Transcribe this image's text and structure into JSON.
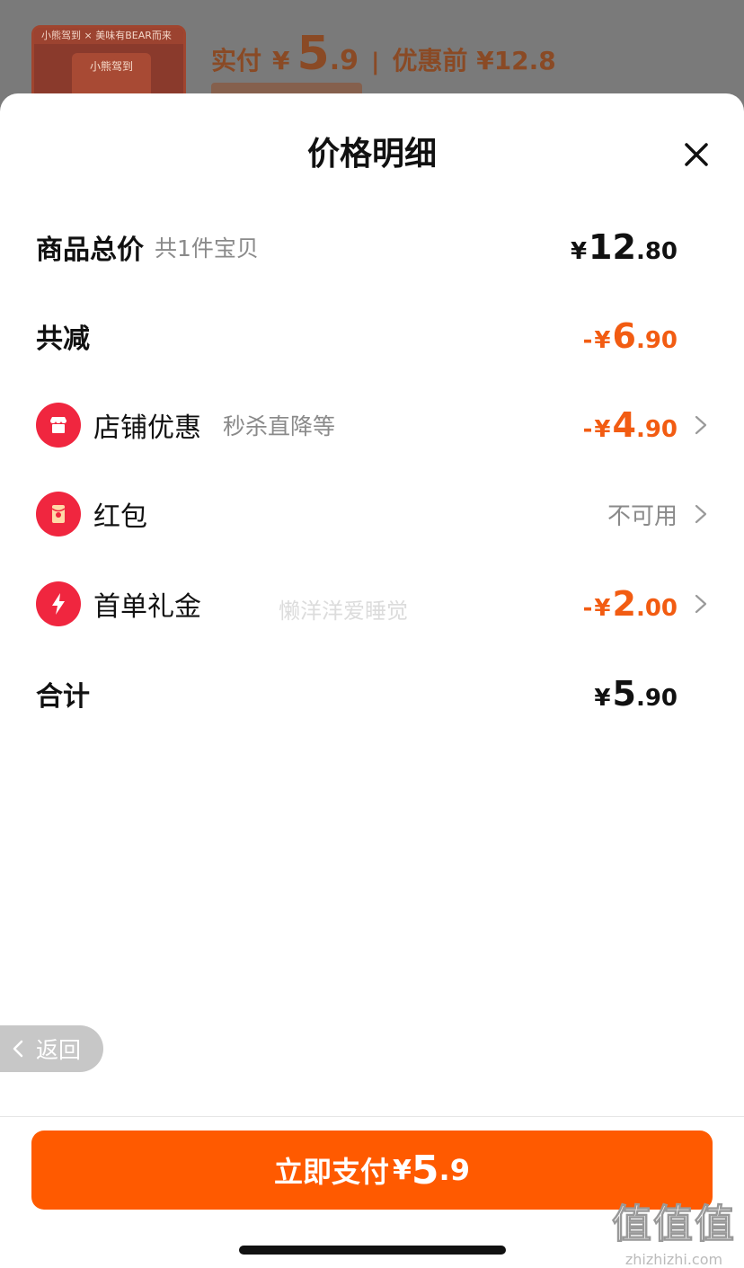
{
  "background": {
    "thumb_brand": "小熊驾到 × 美味有BEAR而来",
    "thumb_title": "小熊驾到",
    "price_label": "实付",
    "price_yen": "¥",
    "price_int": "5",
    "price_dec": ".9",
    "separator": "|",
    "original_price": "优惠前 ¥12.8"
  },
  "sheet": {
    "title": "价格明细",
    "close_icon": "close-icon"
  },
  "rows": {
    "total": {
      "label": "商品总价",
      "sub": "共1件宝贝",
      "yen": "¥",
      "int": "12",
      "dec": ".80"
    },
    "discount_total": {
      "label": "共减",
      "minus": "-",
      "yen": "¥",
      "int": "6",
      "dec": ".90",
      "color": "#f25c12"
    },
    "store_discount": {
      "icon": "store-icon",
      "label": "店铺优惠",
      "sub": "秒杀直降等",
      "minus": "-",
      "yen": "¥",
      "int": "4",
      "dec": ".90"
    },
    "red_packet": {
      "icon": "red-packet-icon",
      "label": "红包",
      "status": "不可用"
    },
    "first_order": {
      "icon": "lightning-icon",
      "label": "首单礼金",
      "minus": "-",
      "yen": "¥",
      "int": "2",
      "dec": ".00"
    },
    "sum": {
      "label": "合计",
      "yen": "¥",
      "int": "5",
      "dec": ".90"
    }
  },
  "watermark": "懒洋洋爱睡觉",
  "back_button": {
    "label": "返回"
  },
  "pay_button": {
    "label": "立即支付",
    "yen": "¥",
    "int": "5",
    "dec": ".9",
    "color": "#ff5a00"
  },
  "site_mark": {
    "glyphs": "值值值",
    "domain": "zhizhizhi.com"
  }
}
